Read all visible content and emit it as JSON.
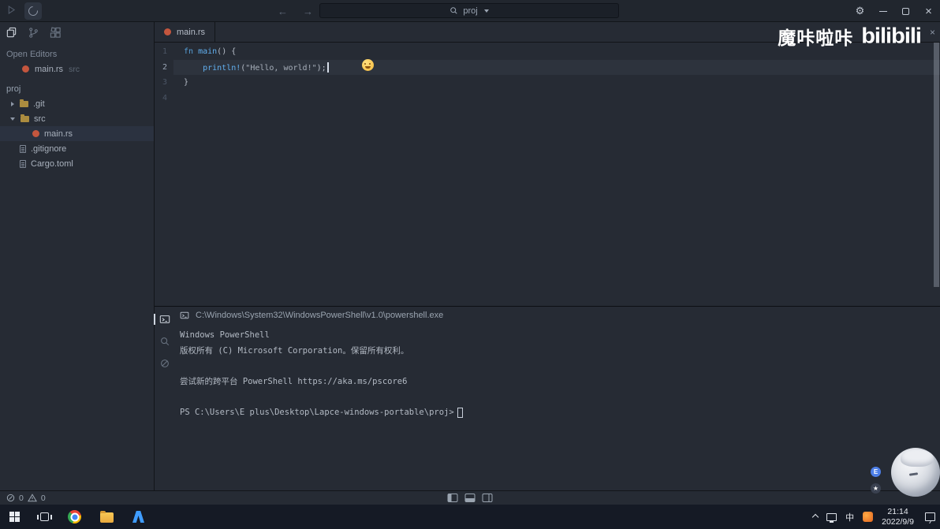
{
  "colors": {
    "bg": "#262b34",
    "bg_dark": "#21262e",
    "border": "#121519",
    "text": "#abb2bf",
    "dim": "#5c6673",
    "accent": "#4aa3ff",
    "keyword": "#569fd6",
    "function_name": "#61afef",
    "string": "#a6aeb9",
    "plain": "#b6bdc8",
    "line_highlight": "#2d333d",
    "selection": "#2b3240",
    "rust_icon": "#c4563e",
    "folder_icon": "#ab8c3f",
    "taskbar_bg": "#151a25",
    "terminal_text": "#b3bac4",
    "watermark": "#ffffff"
  },
  "icons": {
    "back_arrow": "←",
    "forward_arrow": "→",
    "gear": "⚙",
    "window_close": "×",
    "editor_close": "×"
  },
  "titlebar": {
    "search_text": "proj"
  },
  "sidebar": {
    "open_editors_label": "Open Editors",
    "open_editor": {
      "name": "main.rs",
      "folder": "src"
    },
    "project_label": "proj",
    "tree": [
      {
        "label": ".git"
      },
      {
        "label": "src"
      },
      {
        "label": "main.rs"
      },
      {
        "label": ".gitignore"
      },
      {
        "label": "Cargo.toml"
      }
    ]
  },
  "editor": {
    "tab_label": "main.rs",
    "watermark_title": "魔咔啦咔",
    "watermark_brand": "bilibili",
    "emoji_icon": "smiley-face",
    "lines": [
      {
        "num": "1",
        "tokens": [
          {
            "t": "fn"
          },
          {
            "t": " "
          },
          {
            "t": "main"
          },
          {
            "t": "() {"
          }
        ]
      },
      {
        "num": "2",
        "tokens": [
          {
            "t": "    "
          },
          {
            "t": "println!"
          },
          {
            "t": "("
          },
          {
            "t": "\"Hello, world!\""
          },
          {
            "t": ");"
          }
        ]
      },
      {
        "num": "3",
        "tokens": [
          {
            "t": "}"
          }
        ]
      },
      {
        "num": "4",
        "tokens": []
      }
    ]
  },
  "terminal": {
    "tab_path": "C:\\Windows\\System32\\WindowsPowerShell\\v1.0\\powershell.exe",
    "lines": [
      "Windows PowerShell",
      "版权所有 (C) Microsoft Corporation。保留所有权利。",
      "",
      "尝试新的跨平台 PowerShell https://aka.ms/pscore6",
      "",
      "PS C:\\Users\\E plus\\Desktop\\Lapce-windows-portable\\proj>"
    ]
  },
  "statusbar": {
    "error_count": "0",
    "warning_count": "0"
  },
  "taskbar": {
    "time": "21:14",
    "date": "2022/9/9",
    "ime_label": "中"
  },
  "mascot": {
    "badge_letter": "E",
    "badge_star": "★"
  }
}
